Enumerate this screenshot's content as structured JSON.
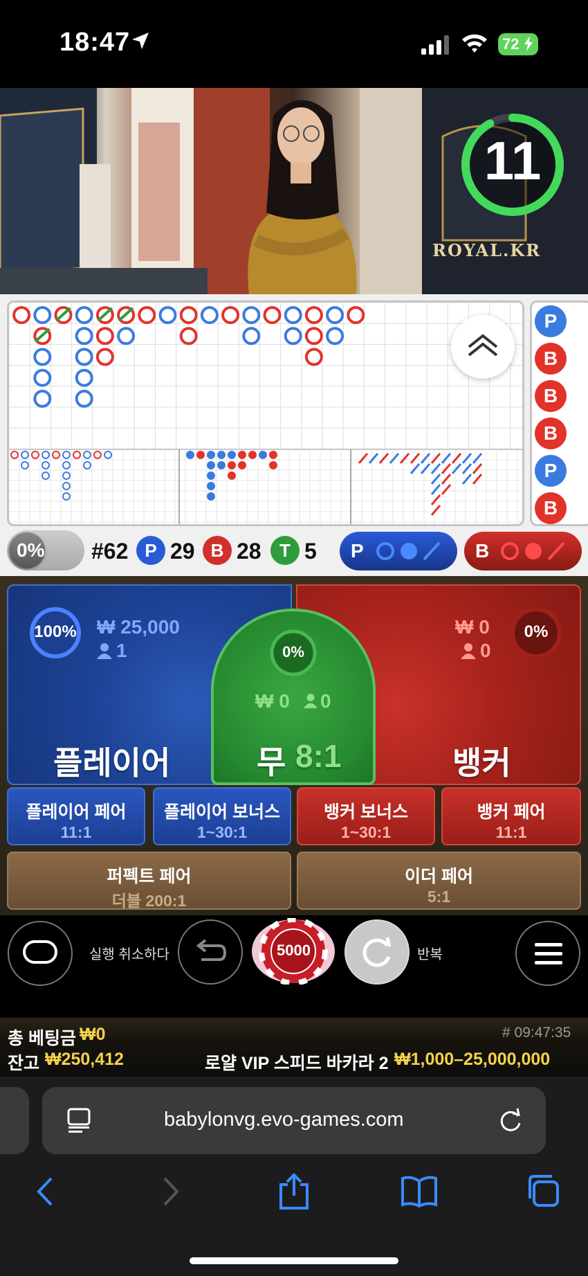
{
  "status_bar": {
    "time": "18:47",
    "battery": "72"
  },
  "video": {
    "timer": "11",
    "timer_progress": 0.92,
    "brand": "ROYAL.KR"
  },
  "roadmap": {
    "side_letters": [
      "P",
      "B",
      "B",
      "B",
      "P",
      "B"
    ]
  },
  "stats": {
    "percent": "0%",
    "round": "#62",
    "player_label": "P",
    "player_count": "29",
    "banker_label": "B",
    "banker_count": "28",
    "tie_label": "T",
    "tie_count": "5",
    "ask_player": "P",
    "ask_banker": "B"
  },
  "bets": {
    "player": {
      "name": "플레이어",
      "percent": "100%",
      "amount": "₩ 25,000",
      "players": "1"
    },
    "tie": {
      "name": "무",
      "odds": "8:1",
      "percent": "0%",
      "amount": "₩ 0",
      "players": "0"
    },
    "banker": {
      "name": "뱅커",
      "percent": "0%",
      "amount": "₩ 0",
      "players": "0"
    },
    "side": [
      {
        "title": "플레이어 페어",
        "odds": "11:1"
      },
      {
        "title": "플레이어 보너스",
        "odds": "1~30:1"
      },
      {
        "title": "뱅커 보너스",
        "odds": "1~30:1"
      },
      {
        "title": "뱅커 페어",
        "odds": "11:1"
      }
    ],
    "perfect_pair": {
      "title": "퍼펙트 페어",
      "odds": "더블 200:1"
    },
    "either_pair": {
      "title": "이더 페어",
      "odds": "5:1"
    }
  },
  "controls": {
    "undo_label": "실행 취소하다",
    "chip_value": "5000",
    "repeat_label": "반복"
  },
  "info": {
    "total_bet_label": "총 베팅금",
    "total_bet": "₩0",
    "balance_label": "잔고",
    "balance": "₩250,412",
    "game_id": "# 09:47:35",
    "table_name": "로얄 VIP 스피드 바카라 2",
    "limits": "₩1,000–25,000,000"
  },
  "browser": {
    "url": "babylonvg.evo-games.com"
  },
  "colors": {
    "player": "#2a5bd7",
    "banker": "#d1302a",
    "tie": "#2e9c3a",
    "gold": "#f4d24a"
  }
}
